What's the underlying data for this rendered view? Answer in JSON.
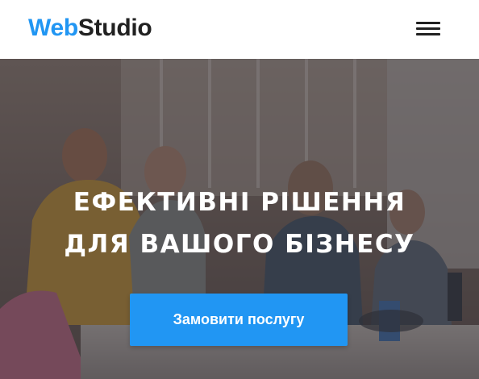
{
  "header": {
    "logo_part1": "Web",
    "logo_part2": "Studio",
    "menu_icon": "hamburger-menu-icon"
  },
  "hero": {
    "title_line1": "ЕФЕКТИВНІ РІШЕННЯ",
    "title_line2": "ДЛЯ ВАШОГО БІЗНЕСУ",
    "button_label": "Замовити послугу",
    "background_image": "office-team-photo"
  },
  "colors": {
    "accent": "#2196f3",
    "text_dark": "#212121",
    "overlay": "#2f303a"
  }
}
